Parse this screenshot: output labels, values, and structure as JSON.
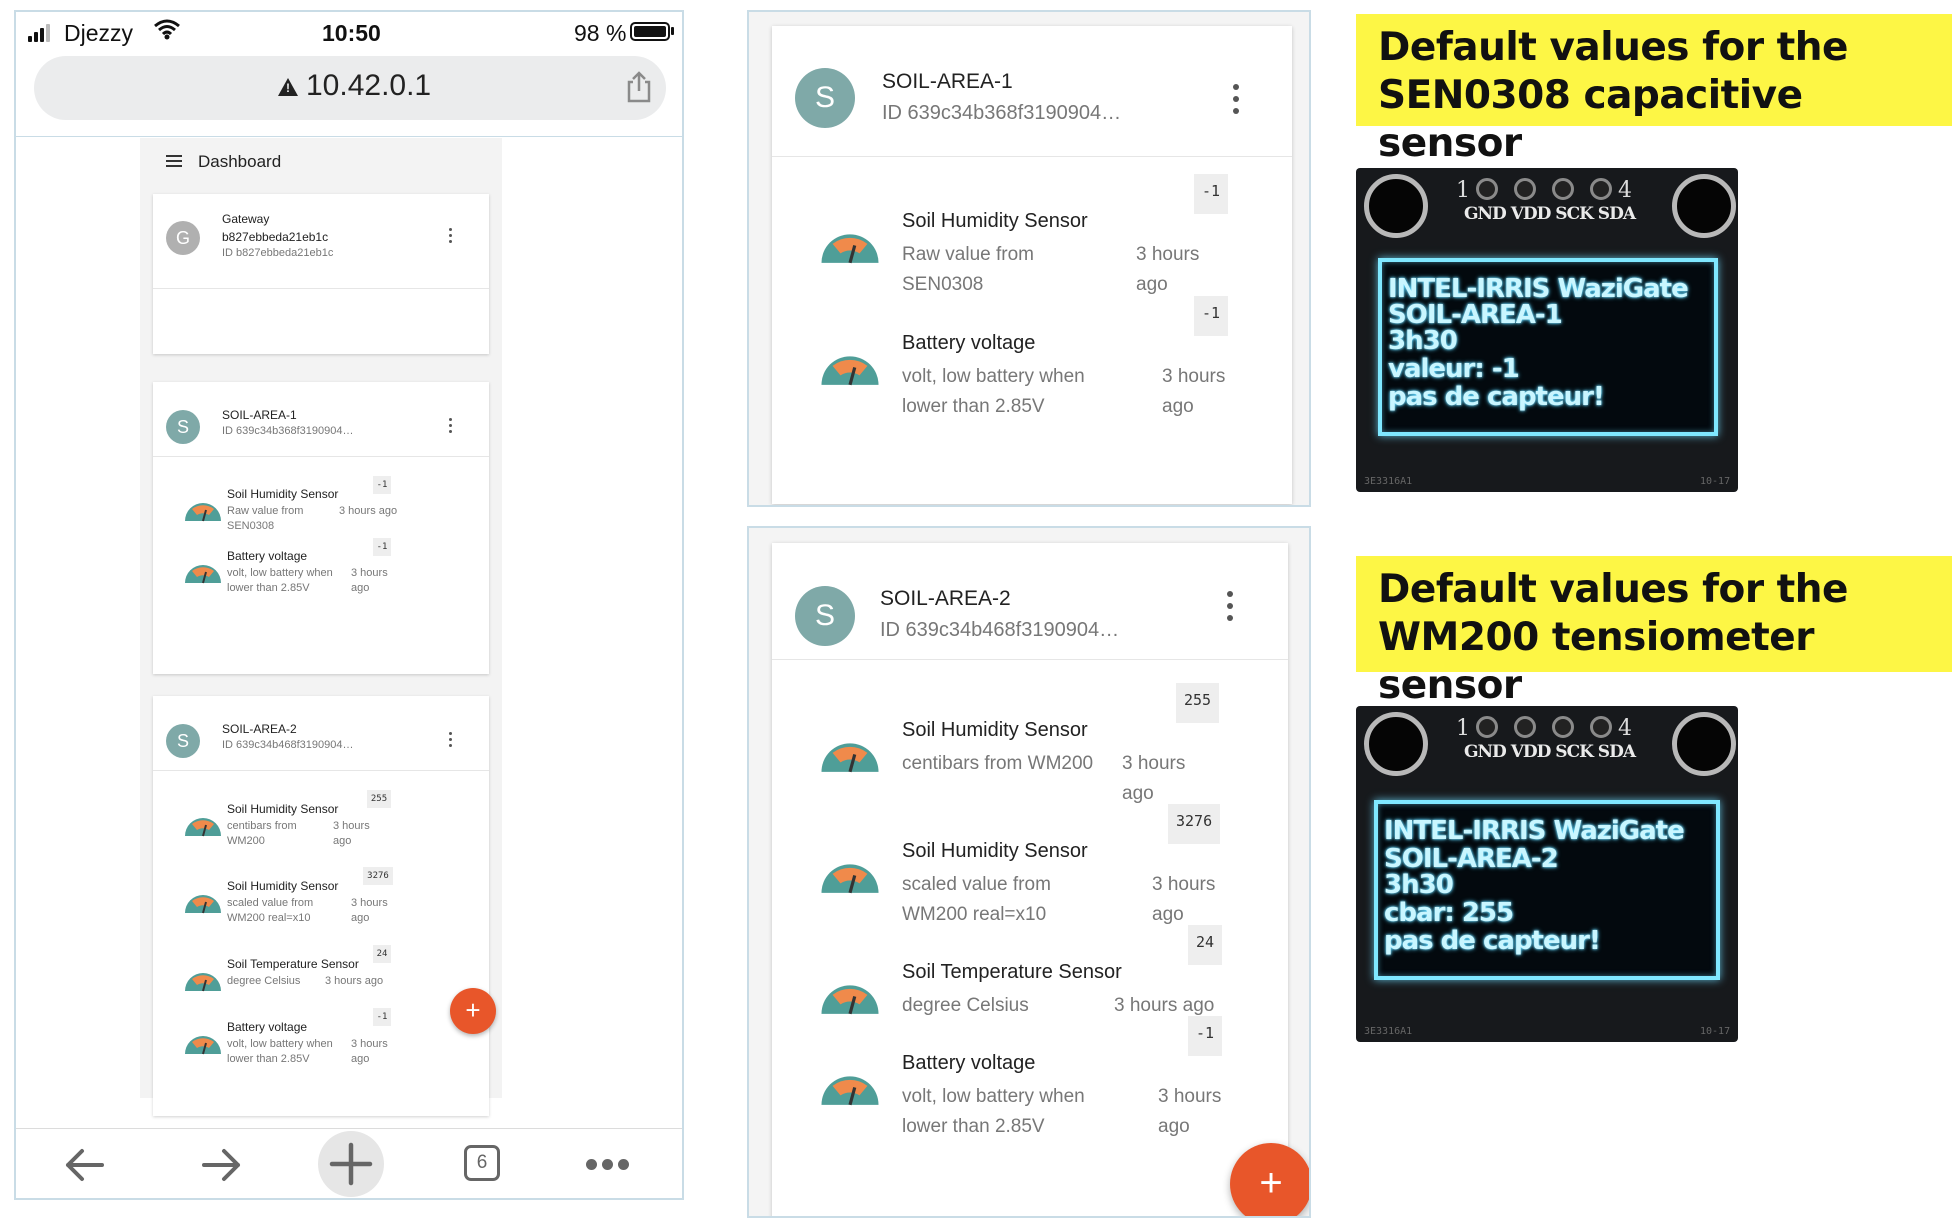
{
  "colors": {
    "avatar_teal": "#7fa9a8",
    "avatar_gray": "#b0b0b0",
    "fab_orange": "#e8562a",
    "note_yellow": "#fdf645",
    "oled_cyan": "#7fe7ff",
    "gauge_green": "#4f9e98",
    "gauge_orange": "#f08a4b"
  },
  "phone": {
    "status": {
      "carrier": "Djezzy",
      "time": "10:50",
      "battery": "98 %"
    },
    "url": "10.42.0.1",
    "app_title": "Dashboard",
    "gateway": {
      "avatar": "G",
      "title": "Gateway",
      "line2": "b827ebbeda21eb1c",
      "line3": "ID b827ebbeda21eb1c"
    },
    "nav": {
      "tab_count": "6"
    },
    "fab": "+"
  },
  "devices": [
    {
      "avatar": "S",
      "name": "SOIL-AREA-1",
      "id": "ID 639c34b368f3190904…",
      "sensors": [
        {
          "icon": "gauge-icon",
          "name": "Soil Humidity Sensor",
          "desc": "Raw value from SEN0308",
          "time": "3 hours ago",
          "value": "-1"
        },
        {
          "icon": "gauge-icon",
          "name": "Battery voltage",
          "desc": "volt, low battery when lower than 2.85V",
          "time": "3 hours ago",
          "value": "-1"
        }
      ]
    },
    {
      "avatar": "S",
      "name": "SOIL-AREA-2",
      "id": "ID 639c34b468f3190904…",
      "sensors": [
        {
          "icon": "gauge-icon",
          "name": "Soil Humidity Sensor",
          "desc": "centibars from WM200",
          "time": "3 hours ago",
          "value": "255"
        },
        {
          "icon": "gauge-icon",
          "name": "Soil Humidity Sensor",
          "desc": "scaled value from WM200 real=x10",
          "time": "3 hours ago",
          "value": "3276"
        },
        {
          "icon": "gauge-icon",
          "name": "Soil Temperature Sensor",
          "desc": "degree Celsius",
          "time": "3 hours ago",
          "value": "24"
        },
        {
          "icon": "gauge-icon",
          "name": "Battery voltage",
          "desc": "volt, low battery when lower than 2.85V",
          "time": "3 hours ago",
          "value": "-1"
        }
      ]
    }
  ],
  "notes": [
    {
      "text": "Default values for the SEN0308 capacitive sensor"
    },
    {
      "text": "Default values for the WM200 tensiometer sensor"
    }
  ],
  "oleds": [
    {
      "pin_left": "1",
      "pin_right": "4",
      "pin_labels": "GND VDD SCK SDA",
      "lines": [
        "INTEL-IRRIS WaziGate",
        "SOIL-AREA-1",
        "3h30",
        "valeur: -1",
        "pas de capteur!"
      ],
      "foot_left": "3E3316A1",
      "foot_right": "10-17"
    },
    {
      "pin_left": "1",
      "pin_right": "4",
      "pin_labels": "GND VDD SCK SDA",
      "lines": [
        "INTEL-IRRIS WaziGate",
        "SOIL-AREA-2",
        "3h30",
        "cbar: 255",
        "pas de capteur!"
      ],
      "foot_left": "3E3316A1",
      "foot_right": "10-17"
    }
  ]
}
